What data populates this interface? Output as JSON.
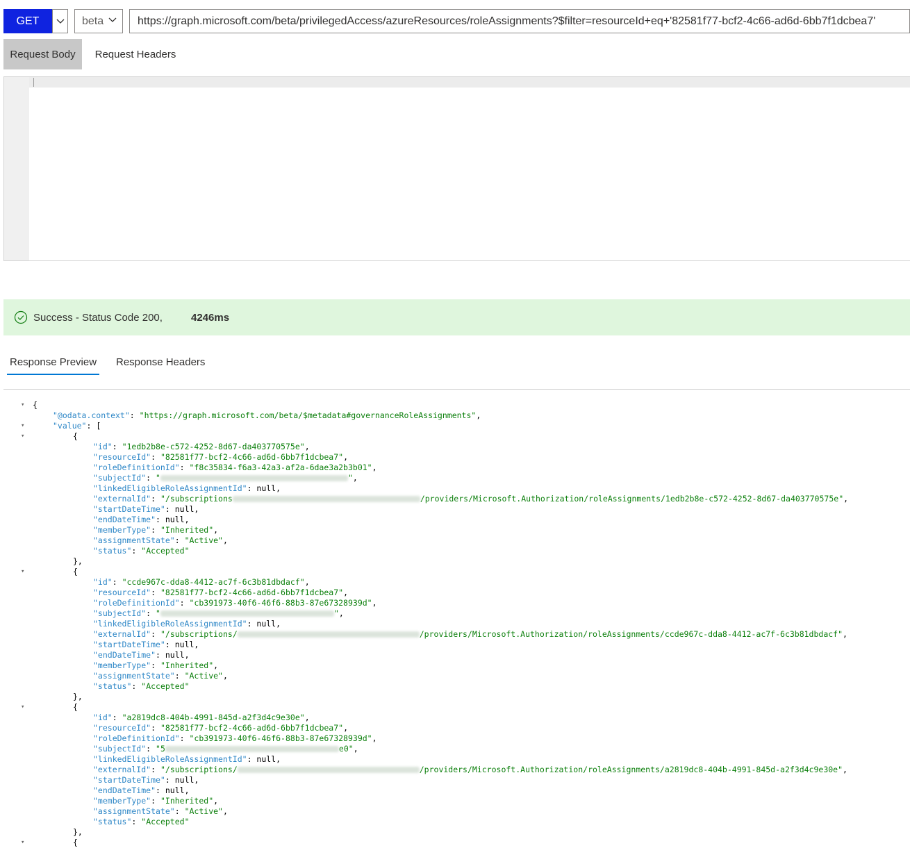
{
  "request": {
    "method": "GET",
    "version": "beta",
    "url": "https://graph.microsoft.com/beta/privilegedAccess/azureResources/roleAssignments?$filter=resourceId+eq+'82581f77-bcf2-4c66-ad6d-6bb7f1dcbea7'"
  },
  "request_tabs": [
    "Request Body",
    "Request Headers"
  ],
  "status": {
    "text": "Success - Status Code 200,",
    "time": "4246ms"
  },
  "response_tabs": [
    "Response Preview",
    "Response Headers"
  ],
  "response": {
    "odata_context": "https://graph.microsoft.com/beta/$metadata#governanceRoleAssignments",
    "items": [
      {
        "id": "1edb2b8e-c572-4252-8d67-da403770575e",
        "resourceId": "82581f77-bcf2-4c66-ad6d-6bb7f1dcbea7",
        "roleDefinitionId": "f8c35834-f6a3-42a3-af2a-6dae3a2b3b01",
        "subjectId_prefix": "",
        "subjectId_suffix": "",
        "linkedEligibleRoleAssignmentId": "null",
        "externalId_prefix": "/subscriptions",
        "externalId_suffix": "/providers/Microsoft.Authorization/roleAssignments/1edb2b8e-c572-4252-8d67-da403770575e",
        "startDateTime": "null",
        "endDateTime": "null",
        "memberType": "Inherited",
        "assignmentState": "Active",
        "status": "Accepted"
      },
      {
        "id": "ccde967c-dda8-4412-ac7f-6c3b81dbdacf",
        "resourceId": "82581f77-bcf2-4c66-ad6d-6bb7f1dcbea7",
        "roleDefinitionId": "cb391973-40f6-46f6-88b3-87e67328939d",
        "subjectId_prefix": "",
        "subjectId_suffix": "",
        "linkedEligibleRoleAssignmentId": "null",
        "externalId_prefix": "/subscriptions/",
        "externalId_suffix": "/providers/Microsoft.Authorization/roleAssignments/ccde967c-dda8-4412-ac7f-6c3b81dbdacf",
        "startDateTime": "null",
        "endDateTime": "null",
        "memberType": "Inherited",
        "assignmentState": "Active",
        "status": "Accepted"
      },
      {
        "id": "a2819dc8-404b-4991-845d-a2f3d4c9e30e",
        "resourceId": "82581f77-bcf2-4c66-ad6d-6bb7f1dcbea7",
        "roleDefinitionId": "cb391973-40f6-46f6-88b3-87e67328939d",
        "subjectId_prefix": "5",
        "subjectId_suffix": "e0",
        "linkedEligibleRoleAssignmentId": "null",
        "externalId_prefix": "/subscriptions/",
        "externalId_suffix": "/providers/Microsoft.Authorization/roleAssignments/a2819dc8-404b-4991-845d-a2f3d4c9e30e",
        "startDateTime": "null",
        "endDateTime": "null",
        "memberType": "Inherited",
        "assignmentState": "Active",
        "status": "Accepted"
      }
    ]
  },
  "colors": {
    "method_button": "#0f23e0",
    "success_bg": "#dff6dd",
    "tab_active_underline": "#0078d4",
    "json_key": "#2e87c7",
    "json_string": "#0b7f0b"
  }
}
